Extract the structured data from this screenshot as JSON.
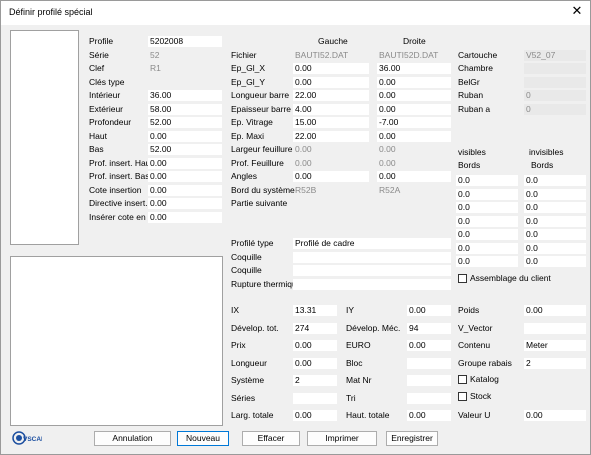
{
  "window": {
    "title": "Définir profilé spécial"
  },
  "left": [
    {
      "label": "Profile",
      "value": "5202008",
      "vk": "white"
    },
    {
      "label": "Série",
      "value": "52",
      "vk": "gray"
    },
    {
      "label": "Clef",
      "value": "R1",
      "vk": "gray"
    },
    {
      "label": "Clés  type",
      "value": "",
      "vk": "none"
    },
    {
      "label": "Intérieur",
      "value": "36.00",
      "vk": "white"
    },
    {
      "label": "Extérieur",
      "value": "58.00",
      "vk": "white"
    },
    {
      "label": "Profondeur",
      "value": "52.00",
      "vk": "white"
    },
    {
      "label": "Haut",
      "value": "0.00",
      "vk": "white"
    },
    {
      "label": "Bas",
      "value": "52.00",
      "vk": "white"
    },
    {
      "label": "Prof. insert. Haut",
      "value": "0.00",
      "vk": "white"
    },
    {
      "label": "Prof. insert. Bas",
      "value": "0.00",
      "vk": "white"
    },
    {
      "label": "Cote insertion",
      "value": "0.00",
      "vk": "white"
    },
    {
      "label": "Directive insert.",
      "value": "0.00",
      "vk": "white"
    },
    {
      "label": "Insérer cote en",
      "value": "0.00",
      "vk": "white"
    }
  ],
  "mid_headers": {
    "left": "Gauche",
    "right": "Droite"
  },
  "mid": [
    {
      "label": "Fichier",
      "g": "BAUTI52.DAT",
      "gk": "gray",
      "d": "BAUTI52D.DAT",
      "dk": "gray"
    },
    {
      "label": "Ep_Gl_X",
      "g": "0.00",
      "gk": "white",
      "d": "36.00",
      "dk": "white"
    },
    {
      "label": "Ep_Gl_Y",
      "g": "0.00",
      "gk": "white",
      "d": "0.00",
      "dk": "white"
    },
    {
      "label": "Longueur barre",
      "g": "22.00",
      "gk": "white",
      "d": "0.00",
      "dk": "white"
    },
    {
      "label": "Epaisseur barre",
      "g": "4.00",
      "gk": "white",
      "d": "0.00",
      "dk": "white"
    },
    {
      "label": "Ep. Vitrage",
      "g": "15.00",
      "gk": "white",
      "d": "-7.00",
      "dk": "white"
    },
    {
      "label": "Ep. Maxi",
      "g": "22.00",
      "gk": "white",
      "d": "0.00",
      "dk": "white"
    },
    {
      "label": "Largeur feuillure",
      "g": "0.00",
      "gk": "gray",
      "d": "0.00",
      "dk": "gray"
    },
    {
      "label": "Prof. Feuillure",
      "g": "0.00",
      "gk": "gray",
      "d": "0.00",
      "dk": "gray"
    },
    {
      "label": "Angles",
      "g": "0.00",
      "gk": "white",
      "d": "0.00",
      "dk": "white"
    },
    {
      "label": "Bord du système",
      "g": "R52B",
      "gk": "gray",
      "d": "R52A",
      "dk": "gray"
    },
    {
      "label": "Partie suivante",
      "g": "",
      "gk": "none",
      "d": "",
      "dk": "none"
    }
  ],
  "wide": [
    {
      "label": "Profilé type",
      "value": "Profilé de cadre"
    },
    {
      "label": "Coquille",
      "value": ""
    },
    {
      "label": "Coquille",
      "value": ""
    },
    {
      "label": "Rupture thermique",
      "value": ""
    }
  ],
  "right_top": [
    {
      "label": "Cartouche",
      "value": "V52_07",
      "vk": "gray"
    },
    {
      "label": "Chambre",
      "value": "",
      "vk": "gray"
    },
    {
      "label": "BelGr",
      "value": "",
      "vk": "gray"
    },
    {
      "label": "Ruban",
      "value": "0",
      "vk": "gray"
    },
    {
      "label": "Ruban a",
      "value": "0",
      "vk": "gray"
    }
  ],
  "right_headers": {
    "visibles": "visibles",
    "invisibles": "invisibles",
    "bords1": "Bords",
    "bords2": "Bords"
  },
  "right_grid": [
    [
      "0.0",
      "0.0"
    ],
    [
      "0.0",
      "0.0"
    ],
    [
      "0.0",
      "0.0"
    ],
    [
      "0.0",
      "0.0"
    ],
    [
      "0.0",
      "0.0"
    ],
    [
      "0.0",
      "0.0"
    ],
    [
      "0.0",
      "0.0"
    ]
  ],
  "assemblage": "Assemblage du client",
  "lower": [
    {
      "l1": "IX",
      "v1": "13.31",
      "k1": "white",
      "l2": "IY",
      "v2": "0.00",
      "k2": "white"
    },
    {
      "l1": "Dévelop. tot.",
      "v1": "274",
      "k1": "white",
      "l2": "Dévelop. Méc.",
      "v2": "94",
      "k2": "white"
    },
    {
      "l1": "Prix",
      "v1": "0.00",
      "k1": "white",
      "l2": "EURO",
      "v2": "0.00",
      "k2": "white"
    },
    {
      "l1": "Longueur",
      "v1": "0.00",
      "k1": "white",
      "l2": "Bloc",
      "v2": "",
      "k2": "white"
    },
    {
      "l1": "Système",
      "v1": "2",
      "k1": "white",
      "l2": "Mat Nr",
      "v2": "",
      "k2": "white"
    },
    {
      "l1": "Séries",
      "v1": "",
      "k1": "white",
      "l2": "Tri",
      "v2": "",
      "k2": "white"
    },
    {
      "l1": "Larg. totale",
      "v1": "0.00",
      "k1": "white",
      "l2": "Haut. totale",
      "v2": "0.00",
      "k2": "white"
    }
  ],
  "lower_right": {
    "poids_label": "Poids",
    "poids": "0.00",
    "vvector_label": "V_Vector",
    "vvector": "",
    "contenu_label": "Contenu",
    "contenu": "Meter",
    "rabais_label": "Groupe rabais",
    "rabais": "2",
    "katalog": "Katalog",
    "stock": "Stock",
    "valeur_label": "Valeur U",
    "valeur": "0.00"
  },
  "buttons": {
    "annulation": "Annulation",
    "nouveau": "Nouveau",
    "effacer": "Effacer",
    "imprimer": "Imprimer",
    "enregistrer": "Enregistrer"
  },
  "logo": {
    "text": "VSCAD",
    "color": "#1c4fa0"
  }
}
